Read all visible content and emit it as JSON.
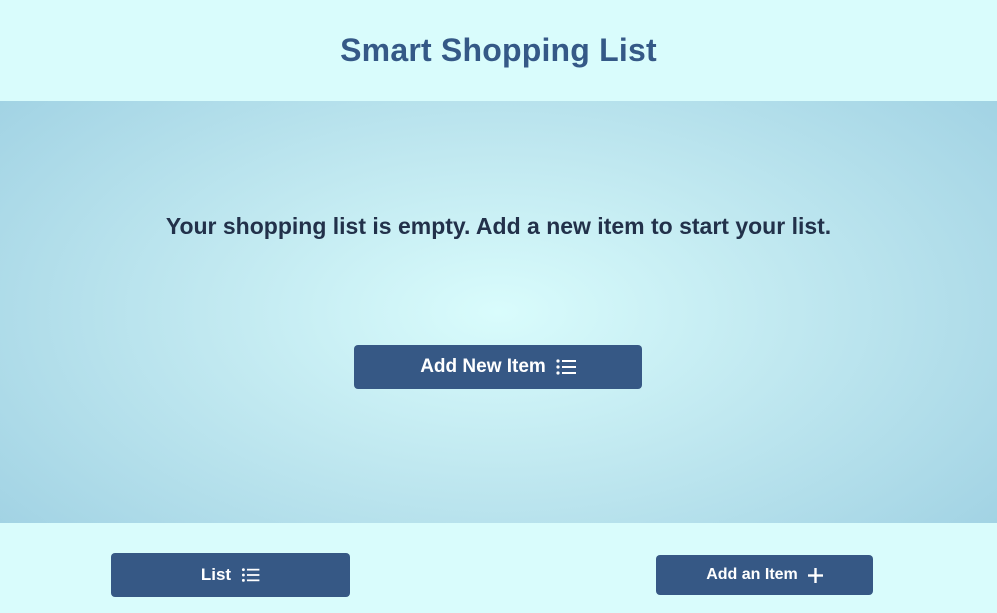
{
  "header": {
    "title": "Smart Shopping List"
  },
  "main": {
    "empty_message": "Your shopping list is empty. Add a new item to start your list.",
    "add_new_button_label": "Add New Item",
    "add_new_button_icon": "list-icon"
  },
  "footer": {
    "list_button_label": "List",
    "list_button_icon": "list-icon",
    "add_item_button_label": "Add an Item",
    "add_item_button_icon": "plus-icon"
  },
  "colors": {
    "background": "#d9fcfc",
    "title": "#355987",
    "button": "#365885",
    "message_text": "#22314a"
  }
}
